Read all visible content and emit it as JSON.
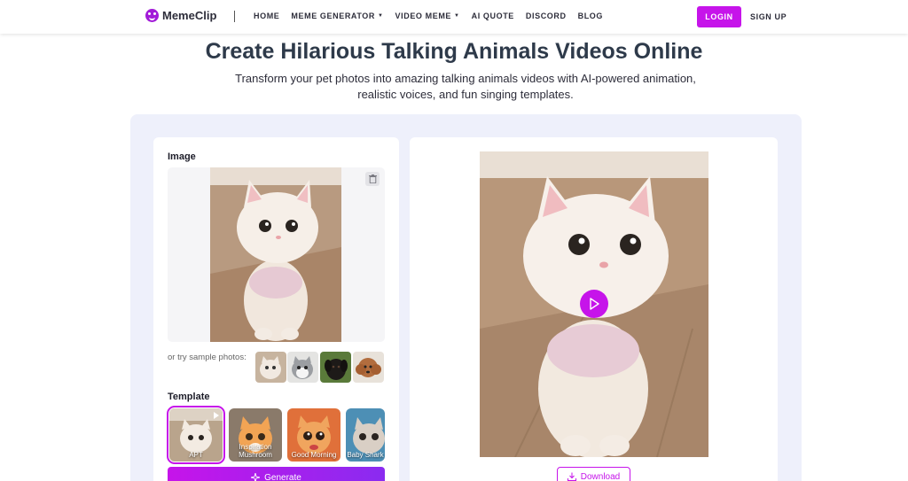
{
  "nav": {
    "brand": "MemeClip",
    "items": [
      {
        "label": "HOME",
        "dropdown": false
      },
      {
        "label": "MEME GENERATOR",
        "dropdown": true
      },
      {
        "label": "VIDEO MEME",
        "dropdown": true
      },
      {
        "label": "AI QUOTE",
        "dropdown": false
      },
      {
        "label": "DISCORD",
        "dropdown": false
      },
      {
        "label": "BLOG",
        "dropdown": false
      }
    ],
    "login": "LOGIN",
    "signup": "SIGN UP"
  },
  "hero": {
    "title": "Create Hilarious Talking Animals Videos Online",
    "subtitle": "Transform your pet photos into amazing talking animals videos with AI-powered animation, realistic voices, and fun singing templates."
  },
  "editor": {
    "image_label": "Image",
    "sample_label": "or try sample photos:",
    "template_label": "Template",
    "templates": [
      {
        "label": "APT",
        "selected": true
      },
      {
        "label": "Inspiration Mushroom",
        "selected": false
      },
      {
        "label": "Good Morning",
        "selected": false
      },
      {
        "label": "Baby Shark",
        "selected": false
      }
    ],
    "generate": "Generate"
  },
  "preview": {
    "download": "Download"
  },
  "colors": {
    "accent": "#c614ea",
    "panel_bg": "#eef0fb"
  }
}
